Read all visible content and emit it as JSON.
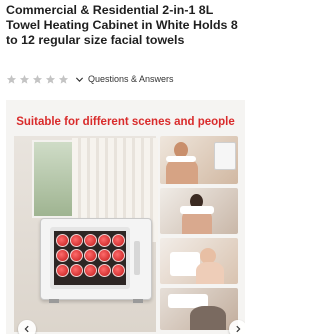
{
  "product": {
    "title": "Commercial & Residential 2-in-1 8L Towel Heating Cabinet in White Holds 8 to 12 regular size facial towels"
  },
  "rating": {
    "stars_filled": 0,
    "stars_total": 5,
    "star_color": "#c4c4c4",
    "qa_label": "Questions & Answers"
  },
  "gallery": {
    "heading": "Suitable for different scenes and people",
    "heading_color": "#d92b2b",
    "prev_icon": "chevron-left-icon",
    "next_icon": "chevron-right-icon"
  }
}
